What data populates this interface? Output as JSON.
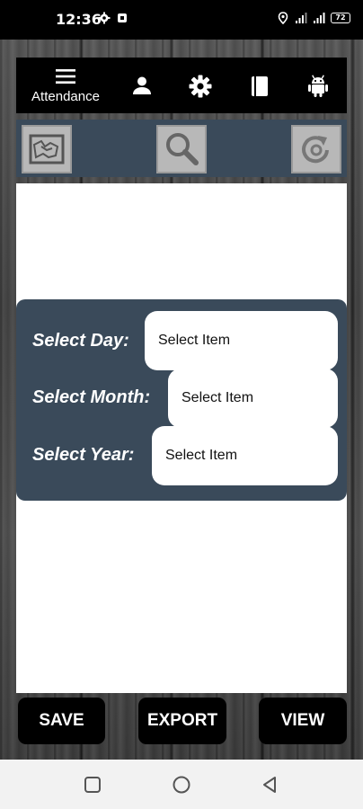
{
  "status_bar": {
    "time": "12:36",
    "battery": "72"
  },
  "toolbar": {
    "menu_label": "Attendance",
    "icons": [
      "menu-icon",
      "person-icon",
      "gear-icon",
      "book-icon",
      "android-icon"
    ]
  },
  "subbar": {
    "icons": [
      "map-icon",
      "search-icon",
      "refresh-icon"
    ]
  },
  "form": {
    "day_label": "Select Day:",
    "day_value": "Select Item",
    "month_label": "Select Month:",
    "month_value": "Select Item",
    "year_label": "Select Year:",
    "year_value": "Select Item"
  },
  "actions": {
    "save_label": "SAVE",
    "export_label": "EXPORT",
    "view_label": "VIEW"
  },
  "colors": {
    "panel": "#3a4a5a",
    "toolbar": "#000000",
    "content": "#ffffff"
  }
}
